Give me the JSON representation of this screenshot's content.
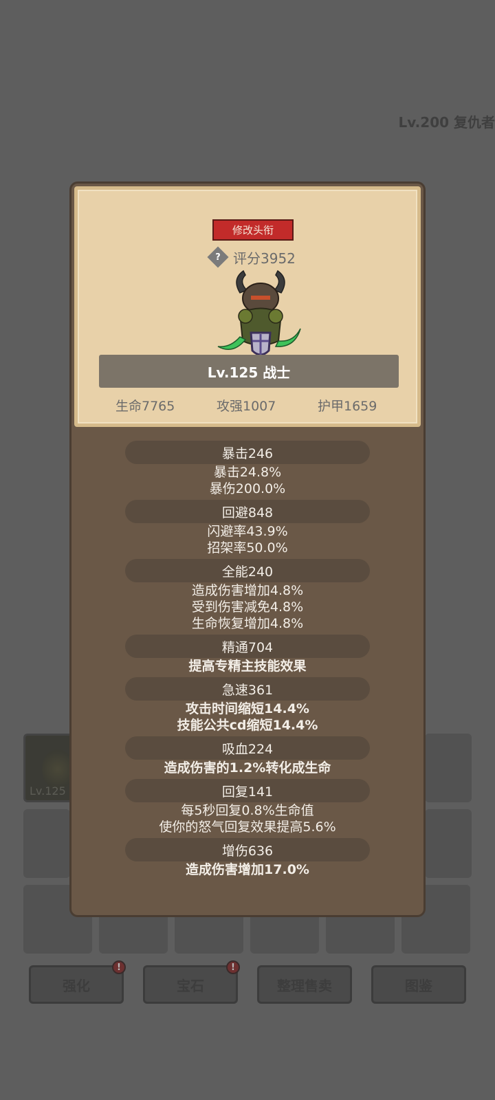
{
  "background": {
    "level_text": "Lv.200 复仇者",
    "equipped_item_level": "Lv.125",
    "bottom_buttons": [
      {
        "label": "强化",
        "badge": "!"
      },
      {
        "label": "宝石",
        "badge": "!"
      },
      {
        "label": "整理售卖"
      },
      {
        "label": "图鉴"
      }
    ]
  },
  "popup": {
    "title_button": "修改头衔",
    "help_icon": "?",
    "score": "评分3952",
    "character_level": "Lv.125 战士",
    "base_stats": {
      "hp": "生命7765",
      "attack": "攻强1007",
      "armor": "护甲1659"
    },
    "stats": [
      {
        "header": "暴击246",
        "lines": [
          "暴击24.8%",
          "暴伤200.0%"
        ]
      },
      {
        "header": "回避848",
        "lines": [
          "闪避率43.9%",
          "招架率50.0%"
        ]
      },
      {
        "header": "全能240",
        "lines": [
          "造成伤害增加4.8%",
          "受到伤害减免4.8%",
          "生命恢复增加4.8%"
        ]
      },
      {
        "header": "精通704",
        "lines": [
          "提高专精主技能效果"
        ]
      },
      {
        "header": "急速361",
        "lines": [
          "攻击时间缩短14.4%",
          "技能公共cd缩短14.4%"
        ]
      },
      {
        "header": "吸血224",
        "lines": [
          "造成伤害的1.2%转化成生命"
        ]
      },
      {
        "header": "回复141",
        "lines": [
          "每5秒回复0.8%生命值",
          "使你的怒气回复效果提高5.6%"
        ]
      },
      {
        "header": "增伤636",
        "lines": [
          "造成伤害增加17.0%"
        ]
      }
    ]
  },
  "colors": {
    "title_button": "#c22b2a",
    "parchment": "#e8d1a9",
    "panel": "#6a5847"
  }
}
